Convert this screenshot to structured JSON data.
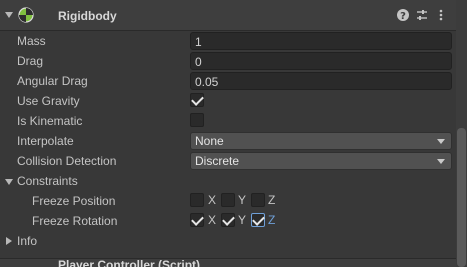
{
  "component": {
    "title": "Rigidbody"
  },
  "properties": {
    "mass": {
      "label": "Mass",
      "value": "1"
    },
    "drag": {
      "label": "Drag",
      "value": "0"
    },
    "angular_drag": {
      "label": "Angular Drag",
      "value": "0.05"
    },
    "use_gravity": {
      "label": "Use Gravity",
      "checked": true
    },
    "is_kinematic": {
      "label": "Is Kinematic",
      "checked": false
    },
    "interpolate": {
      "label": "Interpolate",
      "value": "None"
    },
    "collision_detection": {
      "label": "Collision Detection",
      "value": "Discrete"
    }
  },
  "constraints": {
    "label": "Constraints",
    "freeze_position": {
      "label": "Freeze Position",
      "x": "X",
      "y": "Y",
      "z": "Z",
      "x_on": false,
      "y_on": false,
      "z_on": false
    },
    "freeze_rotation": {
      "label": "Freeze Rotation",
      "x": "X",
      "y": "Y",
      "z": "Z",
      "x_on": true,
      "y_on": true,
      "z_on": true
    }
  },
  "info": {
    "label": "Info"
  },
  "next_component": {
    "title": "Player Controller (Script)"
  },
  "colors": {
    "background": "#383838",
    "field": "#2a2a2a",
    "dropdown": "#515151",
    "focus": "#6fa0d8"
  }
}
